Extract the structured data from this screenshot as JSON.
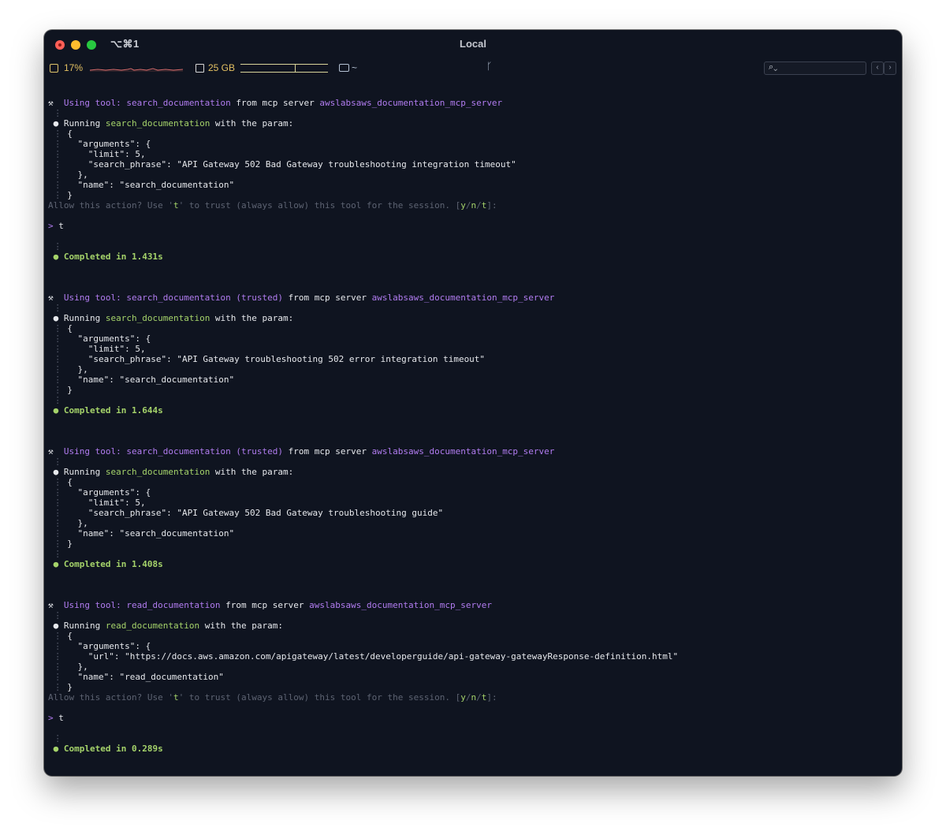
{
  "window": {
    "shortcut": "⌥⌘1",
    "title": "Local",
    "colors": {
      "background": "#0f1420",
      "purple": "#b17cf0",
      "green": "#a5d36a",
      "yellow": "#e3c062"
    }
  },
  "statusbar": {
    "cpu_icon": "cpu-icon",
    "cpu_label": "17%",
    "memory_icon": "memory-icon",
    "memory_label": "25 GB",
    "folder_icon": "folder-icon",
    "folder_label": "~",
    "branch_icon": "git-branch-icon",
    "search_icon": "search-icon",
    "search_value": "",
    "nav_prev": "‹",
    "nav_next": "›"
  },
  "terminal": {
    "tool_icon": "⚒",
    "using_tool": "Using tool:",
    "from_mcp_server": "from mcp server",
    "server": "awslabsaws_documentation_mcp_server",
    "running": "Running",
    "with_the_param": "with the param:",
    "trusted": "(trusted)",
    "prompt": {
      "allow_a": "Allow this action? Use '",
      "t": "t",
      "allow_b": "' to trust (always allow) this tool for the session. [",
      "y": "y",
      "sep": "/",
      "n": "n",
      "allow_c": "]:"
    },
    "caret": ">",
    "answer": "t",
    "completed_prefix": "Completed in",
    "calls": [
      {
        "tool": "search_documentation",
        "args": [
          "{",
          "  \"arguments\": {",
          "    \"limit\": 5,",
          "    \"search_phrase\": \"API Gateway 502 Bad Gateway troubleshooting integration timeout\"",
          "  },",
          "  \"name\": \"search_documentation\"",
          "}"
        ],
        "time": "1.431s"
      },
      {
        "tool": "search_documentation",
        "args": [
          "{",
          "  \"arguments\": {",
          "    \"limit\": 5,",
          "    \"search_phrase\": \"API Gateway troubleshooting 502 error integration timeout\"",
          "  },",
          "  \"name\": \"search_documentation\"",
          "}"
        ],
        "time": "1.644s"
      },
      {
        "tool": "search_documentation",
        "args": [
          "{",
          "  \"arguments\": {",
          "    \"limit\": 5,",
          "    \"search_phrase\": \"API Gateway 502 Bad Gateway troubleshooting guide\"",
          "  },",
          "  \"name\": \"search_documentation\"",
          "}"
        ],
        "time": "1.408s"
      },
      {
        "tool": "read_documentation",
        "args": [
          "{",
          "  \"arguments\": {",
          "    \"url\": \"https://docs.aws.amazon.com/apigateway/latest/developerguide/api-gateway-gatewayResponse-definition.html\"",
          "  },",
          "  \"name\": \"read_documentation\"",
          "}"
        ],
        "time": "0.289s"
      }
    ]
  }
}
